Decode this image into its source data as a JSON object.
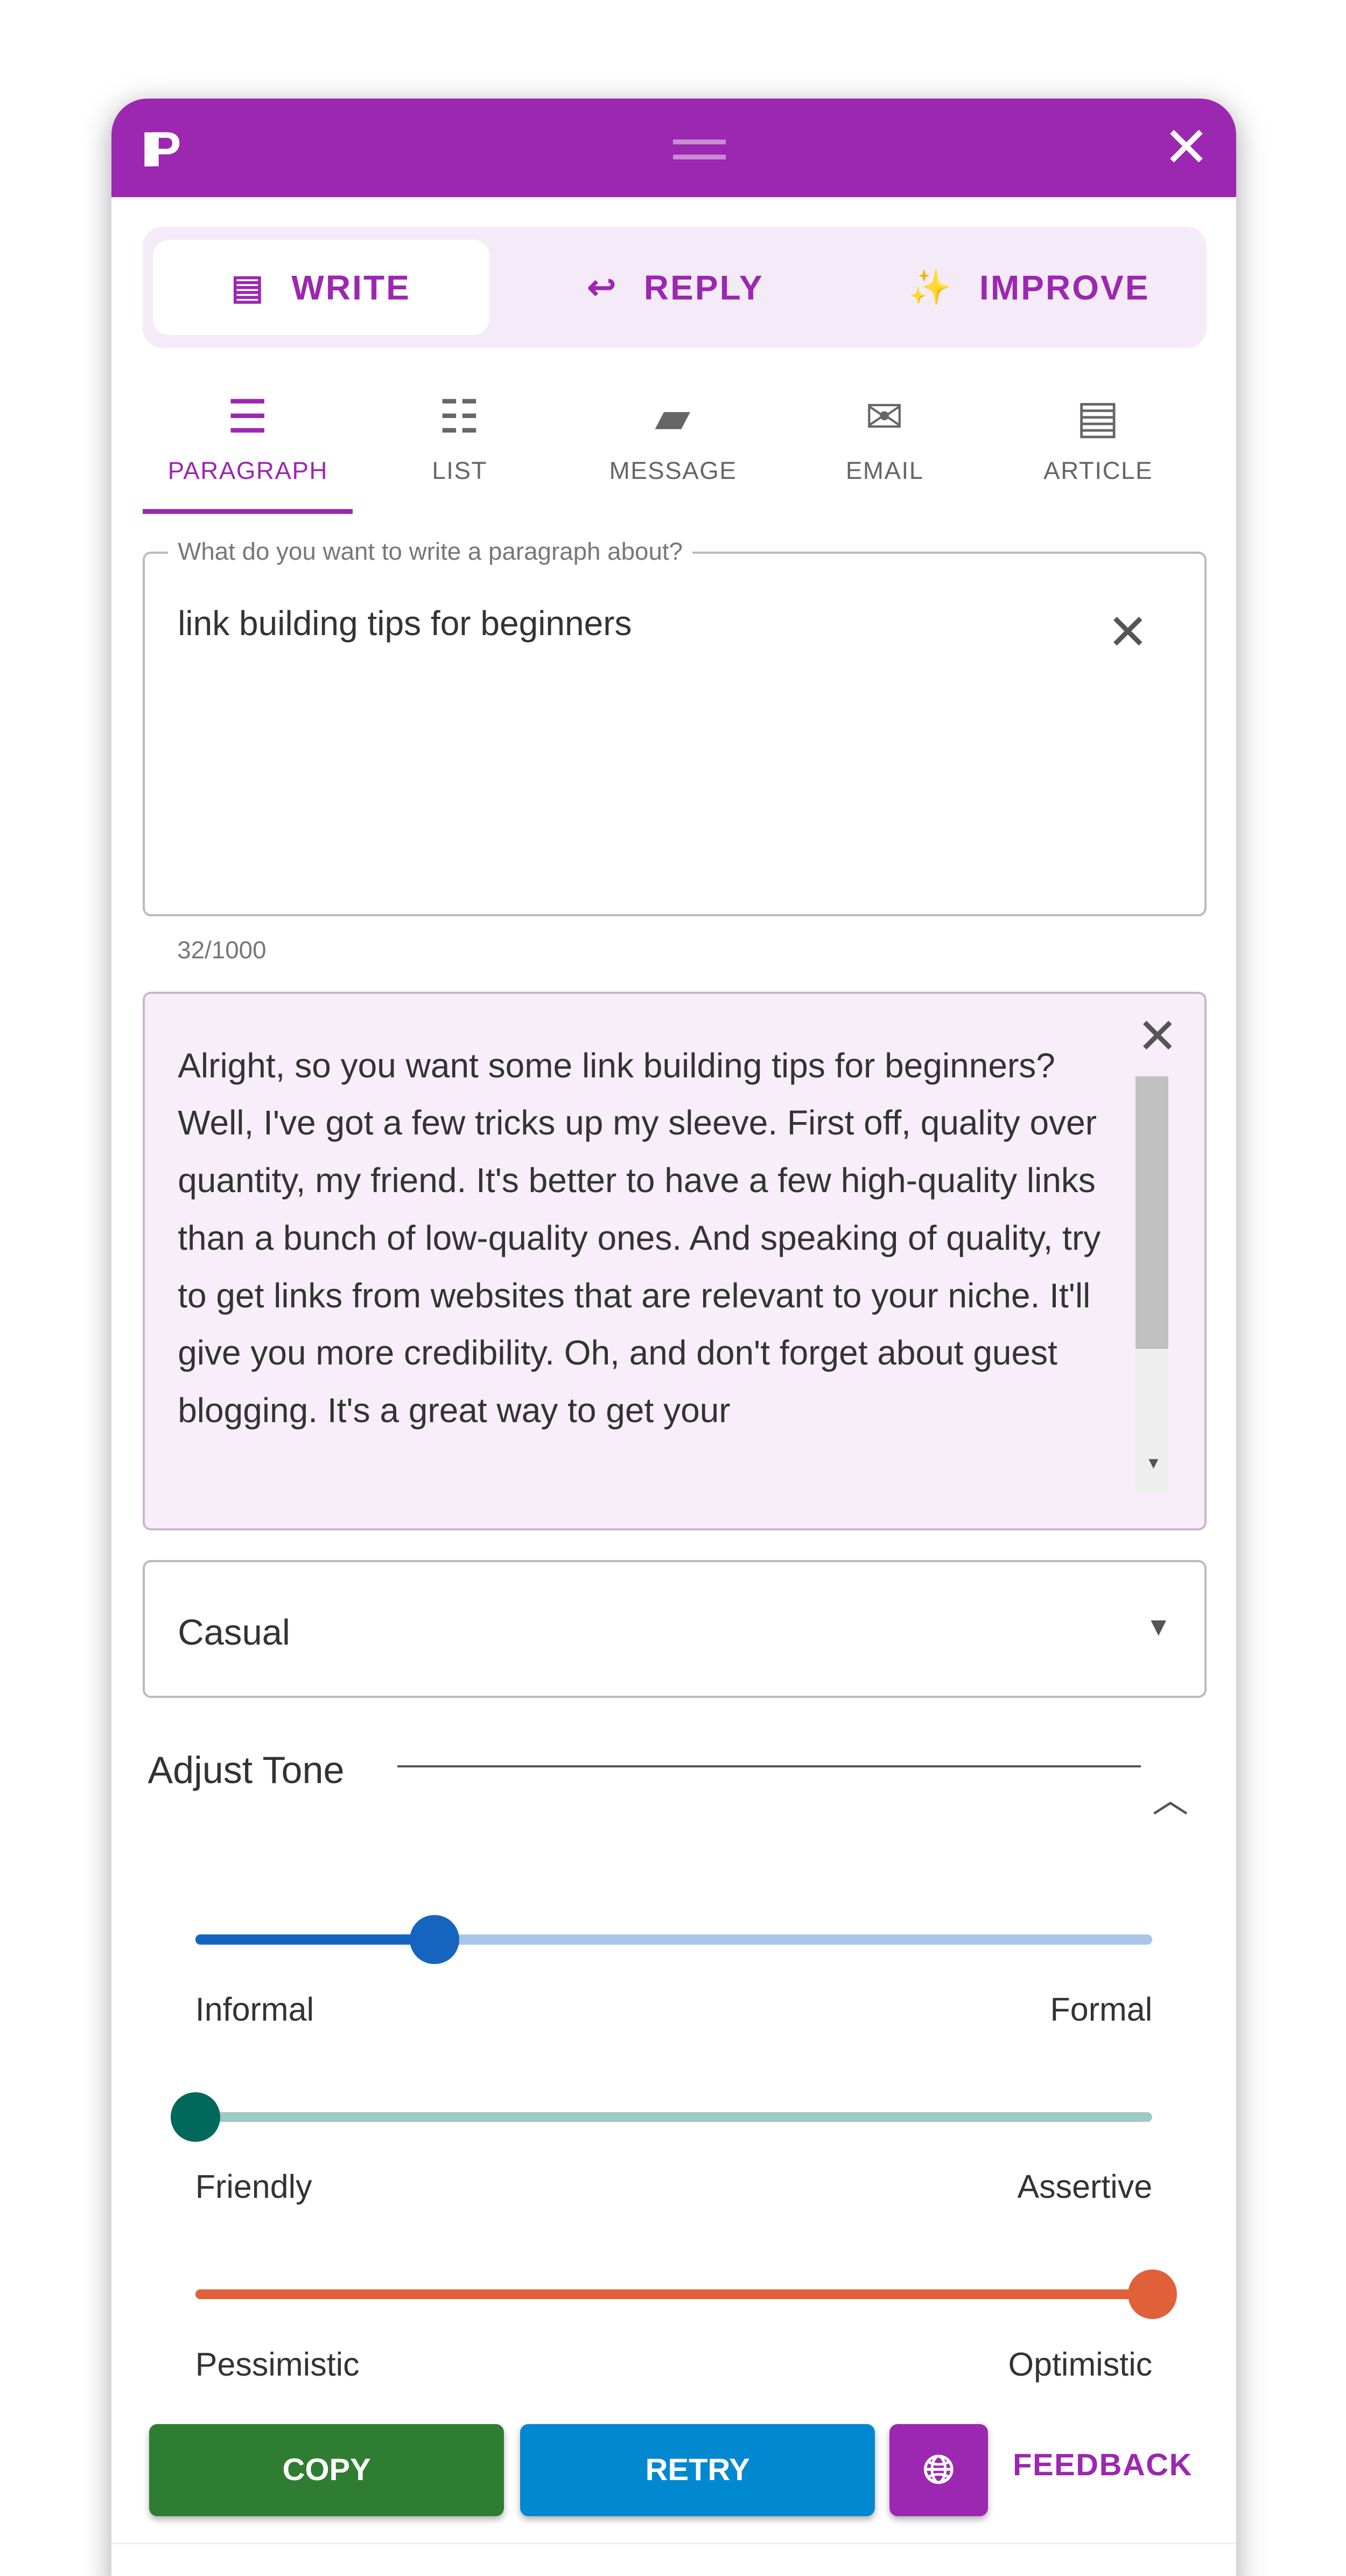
{
  "header": {
    "logo": "IP",
    "close_icon": "close-icon",
    "drag_icon": "drag-handle-icon",
    "color": "#9c27b0"
  },
  "modes": [
    {
      "label": "WRITE",
      "icon": "article-icon",
      "active": true
    },
    {
      "label": "REPLY",
      "icon": "reply-icon"
    },
    {
      "label": "IMPROVE",
      "icon": "magic-wand-icon"
    }
  ],
  "subtabs": [
    {
      "label": "PARAGRAPH",
      "icon": "align-center-icon",
      "active": true
    },
    {
      "label": "LIST",
      "icon": "list-icon"
    },
    {
      "label": "MESSAGE",
      "icon": "message-icon"
    },
    {
      "label": "EMAIL",
      "icon": "email-icon"
    },
    {
      "label": "ARTICLE",
      "icon": "document-icon"
    }
  ],
  "prompt": {
    "label": "What do you want to write a paragraph about?",
    "value": "link building tips for beginners",
    "counter": "32/1000"
  },
  "output": {
    "text": "Alright, so you want some link building tips for beginners? Well, I've got a few tricks up my sleeve. First off, quality over quantity, my friend. It's better to have a few high-quality links than a bunch of low-quality ones. And speaking of quality, try to get links from websites that are relevant to your niche. It'll give you more credibility. Oh, and don't forget about guest blogging. It's a great way to get your"
  },
  "tone_select": {
    "value": "Casual"
  },
  "adjust_tone": {
    "title": "Adjust Tone",
    "sliders": [
      {
        "left": "Informal",
        "right": "Formal",
        "value": 25,
        "color": "#1565c0",
        "track": "#a9c6e8"
      },
      {
        "left": "Friendly",
        "right": "Assertive",
        "value": 0,
        "color": "#00695c",
        "track": "#9fc9c4"
      },
      {
        "left": "Pessimistic",
        "right": "Optimistic",
        "value": 100,
        "color": "#e0603a",
        "track": "#d9603a"
      }
    ]
  },
  "actions": {
    "copy": "COPY",
    "retry": "RETRY",
    "language_icon": "globe-icon",
    "feedback": "FEEDBACK",
    "copy_color": "#2e7d32",
    "retry_color": "#0288d1"
  }
}
